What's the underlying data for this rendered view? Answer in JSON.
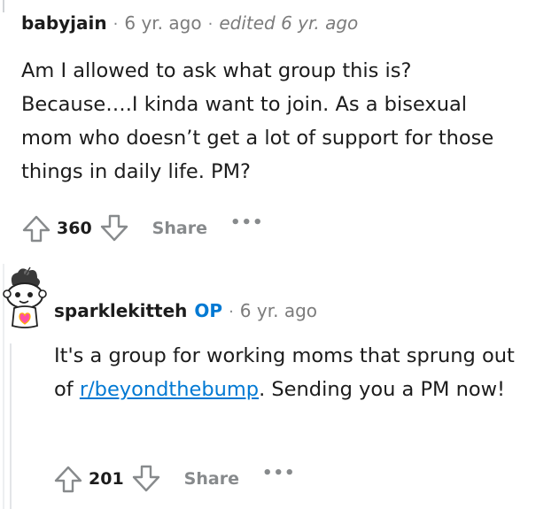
{
  "comment1": {
    "author": "babyjain",
    "separator": "·",
    "age": "6 yr. ago",
    "edited": "edited 6 yr. ago",
    "body": "Am I allowed to ask what group this is? Because….I kinda want to join. As a bisexual mom who doesn’t get a lot of support for those things in daily life. PM?",
    "score": "360",
    "share_label": "Share",
    "more_label": "•••",
    "upvote_icon": "upvote-arrow-icon",
    "downvote_icon": "downvote-arrow-icon"
  },
  "comment2": {
    "author": "sparklekitteh",
    "op_badge": "OP",
    "separator": "·",
    "age": "6 yr. ago",
    "body_before": "It's a group for working moms that sprung out of ",
    "link_text": "r/beyondthebump",
    "body_after": ". Sending you a PM now!",
    "score": "201",
    "share_label": "Share",
    "more_label": "•••",
    "avatar_icon": "snoo-avatar-icon"
  },
  "colors": {
    "accent_link": "#0079d3",
    "muted_text": "#878a8c",
    "primary_text": "#1c1c1c"
  }
}
